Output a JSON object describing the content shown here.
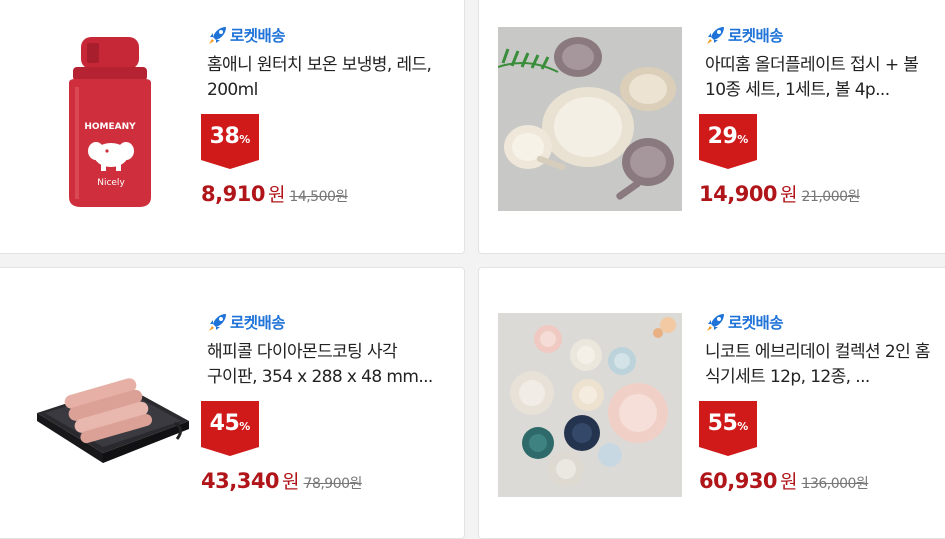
{
  "shipping_badge_label": "로켓배송",
  "products": [
    {
      "title": "홈애니 원터치 보온 보냉병, 레드, 200ml",
      "discount": "38",
      "discount_unit": "%",
      "price": "8,910",
      "currency": "원",
      "original_price": "14,500원",
      "bottle_logo": "HOMEANY",
      "bottle_caption": "Nicely"
    },
    {
      "title": "아띠홈 올더플레이트 접시 + 볼 10종 세트, 1세트, 볼 4p...",
      "discount": "29",
      "discount_unit": "%",
      "price": "14,900",
      "currency": "원",
      "original_price": "21,000원"
    },
    {
      "title": "해피콜 다이아몬드코팅 사각 구이판, 354 x 288 x 48 mm...",
      "discount": "45",
      "discount_unit": "%",
      "price": "43,340",
      "currency": "원",
      "original_price": "78,900원"
    },
    {
      "title": "니코트 에브리데이 컬렉션 2인 홈 식기세트 12p, 12종, ...",
      "discount": "55",
      "discount_unit": "%",
      "price": "60,930",
      "currency": "원",
      "original_price": "136,000원"
    }
  ],
  "colors": {
    "rocket_blue": "#1f73d8",
    "discount_red": "#d01a1a",
    "price_red": "#b0151a"
  }
}
